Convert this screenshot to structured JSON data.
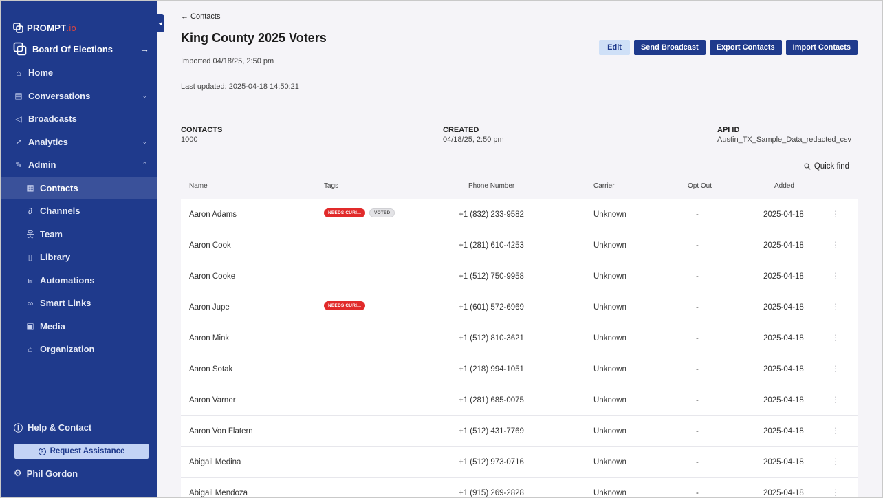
{
  "sidebar": {
    "brand": {
      "name": "PROMPT",
      "suffix": ".io"
    },
    "org": {
      "label": "Board Of Elections",
      "arrow": "→"
    },
    "collapse": "◂",
    "items": [
      {
        "label": "Home",
        "icon": "⌂"
      },
      {
        "label": "Conversations",
        "icon": "▤",
        "chevron": "⌄"
      },
      {
        "label": "Broadcasts",
        "icon": "◁"
      },
      {
        "label": "Analytics",
        "icon": "↗",
        "chevron": "⌄"
      },
      {
        "label": "Admin",
        "icon": "✎",
        "chevron": "⌃"
      },
      {
        "label": "Contacts",
        "icon": "▦"
      },
      {
        "label": "Channels",
        "icon": "∂"
      },
      {
        "label": "Team",
        "icon": "웃"
      },
      {
        "label": "Library",
        "icon": "▯"
      },
      {
        "label": "Automations",
        "icon": "⩎"
      },
      {
        "label": "Smart Links",
        "icon": "∞"
      },
      {
        "label": "Media",
        "icon": "▣"
      },
      {
        "label": "Organization",
        "icon": "⌂"
      }
    ],
    "help": {
      "label": "Help & Contact",
      "icon": "ⓘ"
    },
    "assist": {
      "label": "Request Assistance",
      "icon": "?"
    },
    "user": {
      "label": "Phil Gordon",
      "icon": "⚙"
    }
  },
  "main": {
    "back": "← Contacts",
    "title": "King County 2025 Voters",
    "imported": "Imported 04/18/25, 2:50 pm",
    "updated": "Last updated: 2025-04-18 14:50:21",
    "buttons": {
      "edit": "Edit",
      "broadcast": "Send Broadcast",
      "export": "Export Contacts",
      "import": "Import Contacts"
    },
    "stats": {
      "contacts_label": "CONTACTS",
      "contacts_value": "1000",
      "created_label": "CREATED",
      "created_value": "04/18/25, 2:50 pm",
      "api_label": "API ID",
      "api_value": "Austin_TX_Sample_Data_redacted_csv"
    },
    "quick_find": "Quick find",
    "columns": {
      "name": "Name",
      "tags": "Tags",
      "phone": "Phone Number",
      "carrier": "Carrier",
      "optout": "Opt Out",
      "added": "Added"
    },
    "rows": [
      {
        "name": "Aaron Adams",
        "tags": [
          "NEEDS CURI...",
          "VOTED"
        ],
        "phone": "+1 (832) 233-9582",
        "carrier": "Unknown",
        "optout": "-",
        "added": "2025-04-18"
      },
      {
        "name": "Aaron Cook",
        "tags": [],
        "phone": "+1 (281) 610-4253",
        "carrier": "Unknown",
        "optout": "-",
        "added": "2025-04-18"
      },
      {
        "name": "Aaron Cooke",
        "tags": [],
        "phone": "+1 (512) 750-9958",
        "carrier": "Unknown",
        "optout": "-",
        "added": "2025-04-18"
      },
      {
        "name": "Aaron Jupe",
        "tags": [
          "NEEDS CURI..."
        ],
        "phone": "+1 (601) 572-6969",
        "carrier": "Unknown",
        "optout": "-",
        "added": "2025-04-18"
      },
      {
        "name": "Aaron Mink",
        "tags": [],
        "phone": "+1 (512) 810-3621",
        "carrier": "Unknown",
        "optout": "-",
        "added": "2025-04-18"
      },
      {
        "name": "Aaron Sotak",
        "tags": [],
        "phone": "+1 (218) 994-1051",
        "carrier": "Unknown",
        "optout": "-",
        "added": "2025-04-18"
      },
      {
        "name": "Aaron Varner",
        "tags": [],
        "phone": "+1 (281) 685-0075",
        "carrier": "Unknown",
        "optout": "-",
        "added": "2025-04-18"
      },
      {
        "name": "Aaron Von Flatern",
        "tags": [],
        "phone": "+1 (512) 431-7769",
        "carrier": "Unknown",
        "optout": "-",
        "added": "2025-04-18"
      },
      {
        "name": "Abigail Medina",
        "tags": [],
        "phone": "+1 (512) 973-0716",
        "carrier": "Unknown",
        "optout": "-",
        "added": "2025-04-18"
      },
      {
        "name": "Abigail Mendoza",
        "tags": [],
        "phone": "+1 (915) 269-2828",
        "carrier": "Unknown",
        "optout": "-",
        "added": "2025-04-18"
      }
    ]
  },
  "colors": {
    "sidebar": "#1f3a8c",
    "active": "#3a519a",
    "tag_red": "#e12a2a",
    "accent_light": "#cfe0f7"
  }
}
